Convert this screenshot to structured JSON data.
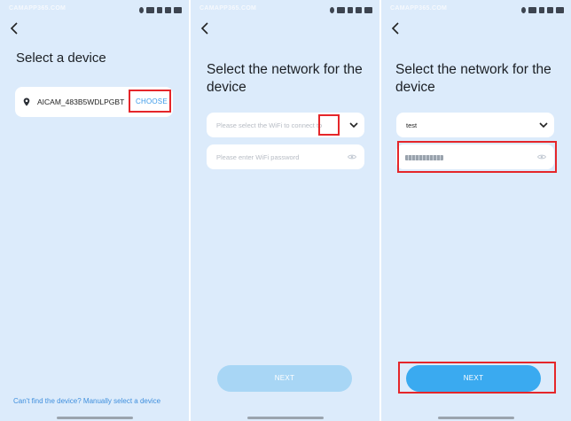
{
  "watermark": "CAMAPP365.COM",
  "screen1": {
    "title": "Select a device",
    "device_name": "AICAM_483B5WDLPGBT",
    "choose_label": "CHOOSE",
    "manual_link": "Can't find the device? Manually select a device"
  },
  "screen2": {
    "title": "Select the network for the device",
    "wifi_placeholder": "Please select the WiFi to connect to",
    "password_placeholder": "Please enter WiFi password",
    "next_label": "NEXT"
  },
  "screen3": {
    "title": "Select the network for the device",
    "wifi_value": "test",
    "next_label": "NEXT"
  },
  "colors": {
    "background": "#dcebfb",
    "accent": "#3aaaf0",
    "highlight": "#e5262a",
    "link": "#3f8fdd"
  }
}
